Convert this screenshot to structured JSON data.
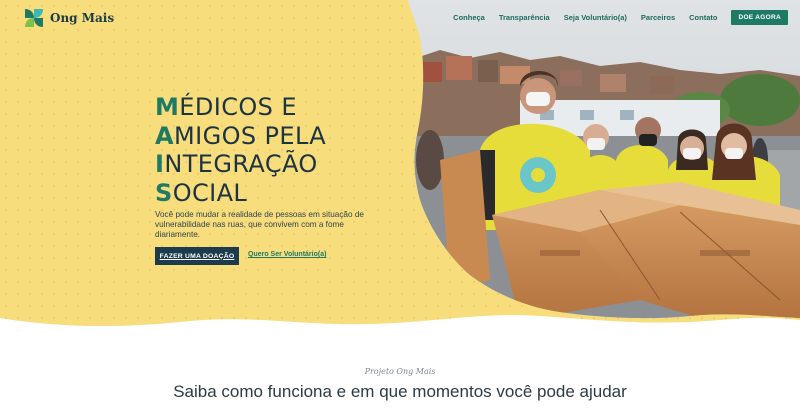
{
  "brand": {
    "name": "Ong Mais"
  },
  "nav": {
    "items": [
      "Conheça",
      "Transparência",
      "Seja Voluntário(a)",
      "Parceiros",
      "Contato"
    ],
    "cta": "DOE AGORA"
  },
  "hero": {
    "headline": [
      {
        "first": "M",
        "rest": "ÉDICOS E"
      },
      {
        "first": "A",
        "rest": "MIGOS PELA"
      },
      {
        "first": "I",
        "rest": "NTEGRAÇÃO"
      },
      {
        "first": "S",
        "rest": "OCIAL"
      }
    ],
    "description": "Você pode mudar a realidade de pessoas em situação de vulnerabilidade nas ruas, que convivem com a fome diariamente.",
    "primary_button": "FAZER UMA DOAÇÃO",
    "secondary_link": "Quero Ser Voluntário(a)"
  },
  "section": {
    "kicker": "Projeto Ong Mais",
    "title": "Saiba como funciona e em que momentos você pode ajudar"
  },
  "colors": {
    "yellow": "#f8dd7c",
    "green": "#1f7a63",
    "navy": "#1c3b4c"
  }
}
